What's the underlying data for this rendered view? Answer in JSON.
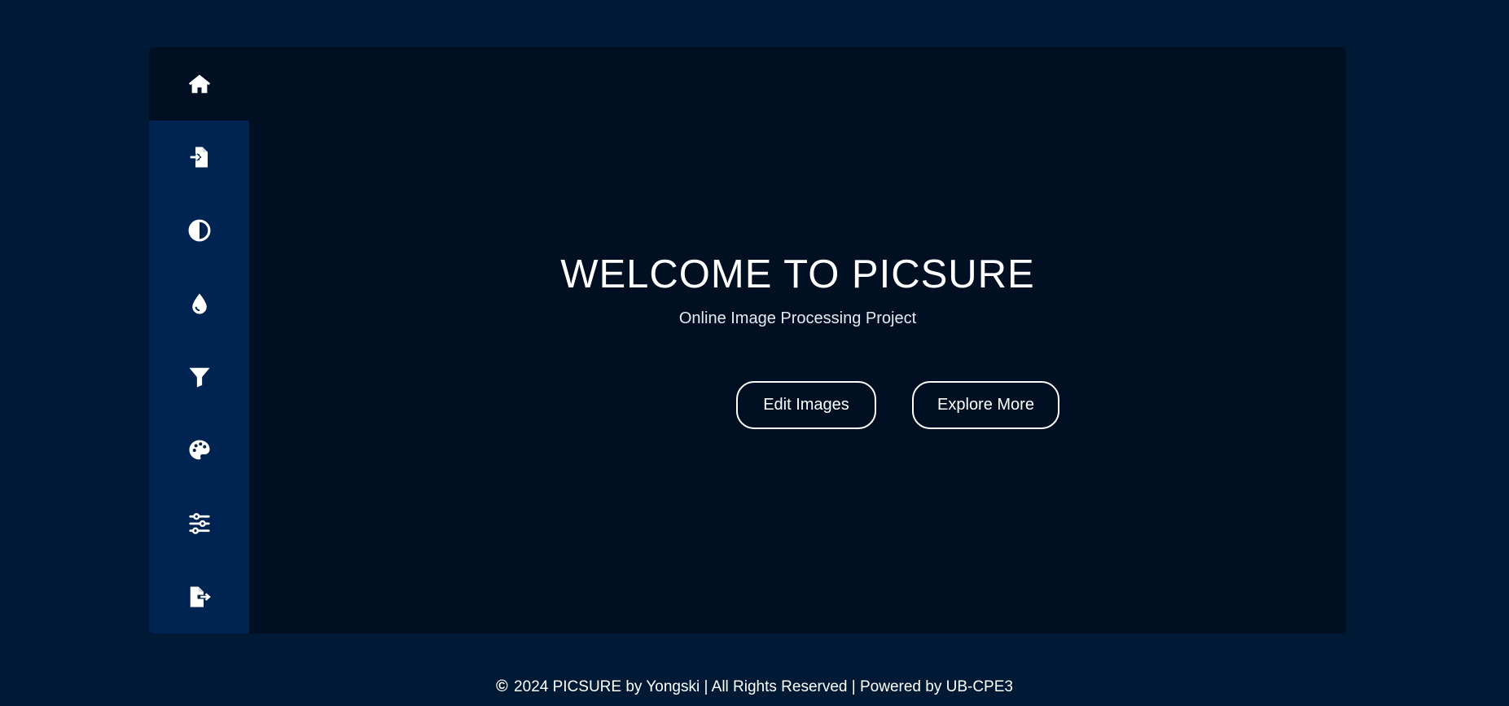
{
  "sidebar": {
    "items": [
      {
        "id": "home",
        "icon": "home-icon",
        "active": true
      },
      {
        "id": "import",
        "icon": "file-import-icon",
        "active": false
      },
      {
        "id": "contrast",
        "icon": "contrast-icon",
        "active": false
      },
      {
        "id": "color-drop",
        "icon": "droplet-icon",
        "active": false
      },
      {
        "id": "filter",
        "icon": "filter-icon",
        "active": false
      },
      {
        "id": "palette",
        "icon": "palette-icon",
        "active": false
      },
      {
        "id": "adjust",
        "icon": "sliders-icon",
        "active": false
      },
      {
        "id": "export",
        "icon": "file-export-icon",
        "active": false
      }
    ]
  },
  "hero": {
    "title": "WELCOME TO PICSURE",
    "subtitle": "Online Image Processing Project",
    "edit_button": "Edit Images",
    "explore_button": "Explore More"
  },
  "footer": {
    "copyright_symbol": "©",
    "text": " 2024 PICSURE by Yongski | All Rights Reserved | Powered by UB-CPE3"
  },
  "colors": {
    "page_background": "#001a36",
    "panel_background": "#000f21",
    "sidebar_background": "#002451",
    "text": "#ffffff"
  }
}
